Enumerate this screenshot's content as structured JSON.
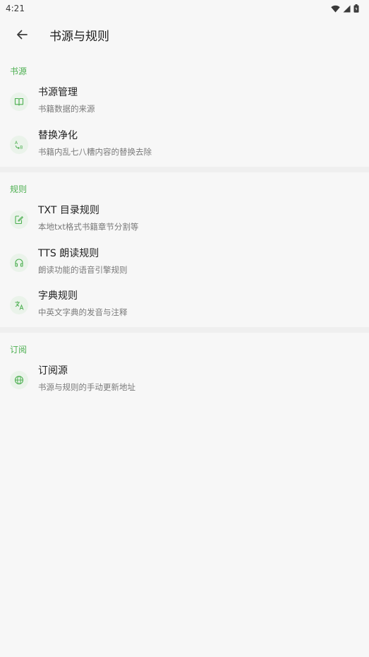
{
  "status_bar": {
    "time": "4:21"
  },
  "app_bar": {
    "title": "书源与规则"
  },
  "colors": {
    "accent": "#4caf50",
    "icon_bg": "#eaf3ea"
  },
  "sections": [
    {
      "header": "书源",
      "items": [
        {
          "title": "书源管理",
          "subtitle": "书籍数据的来源",
          "icon": "book-icon"
        },
        {
          "title": "替换净化",
          "subtitle": "书籍内乱七八糟内容的替换去除",
          "icon": "find-replace-icon"
        }
      ]
    },
    {
      "header": "规则",
      "items": [
        {
          "title": "TXT 目录规则",
          "subtitle": "本地txt格式书籍章节分割等",
          "icon": "edit-note-icon"
        },
        {
          "title": "TTS 朗读规则",
          "subtitle": "朗读功能的语音引擎规则",
          "icon": "headphones-icon"
        },
        {
          "title": "字典规则",
          "subtitle": "中英文字典的发音与注释",
          "icon": "translate-icon"
        }
      ]
    },
    {
      "header": "订阅",
      "items": [
        {
          "title": "订阅源",
          "subtitle": "书源与规则的手动更新地址",
          "icon": "globe-icon"
        }
      ]
    }
  ]
}
